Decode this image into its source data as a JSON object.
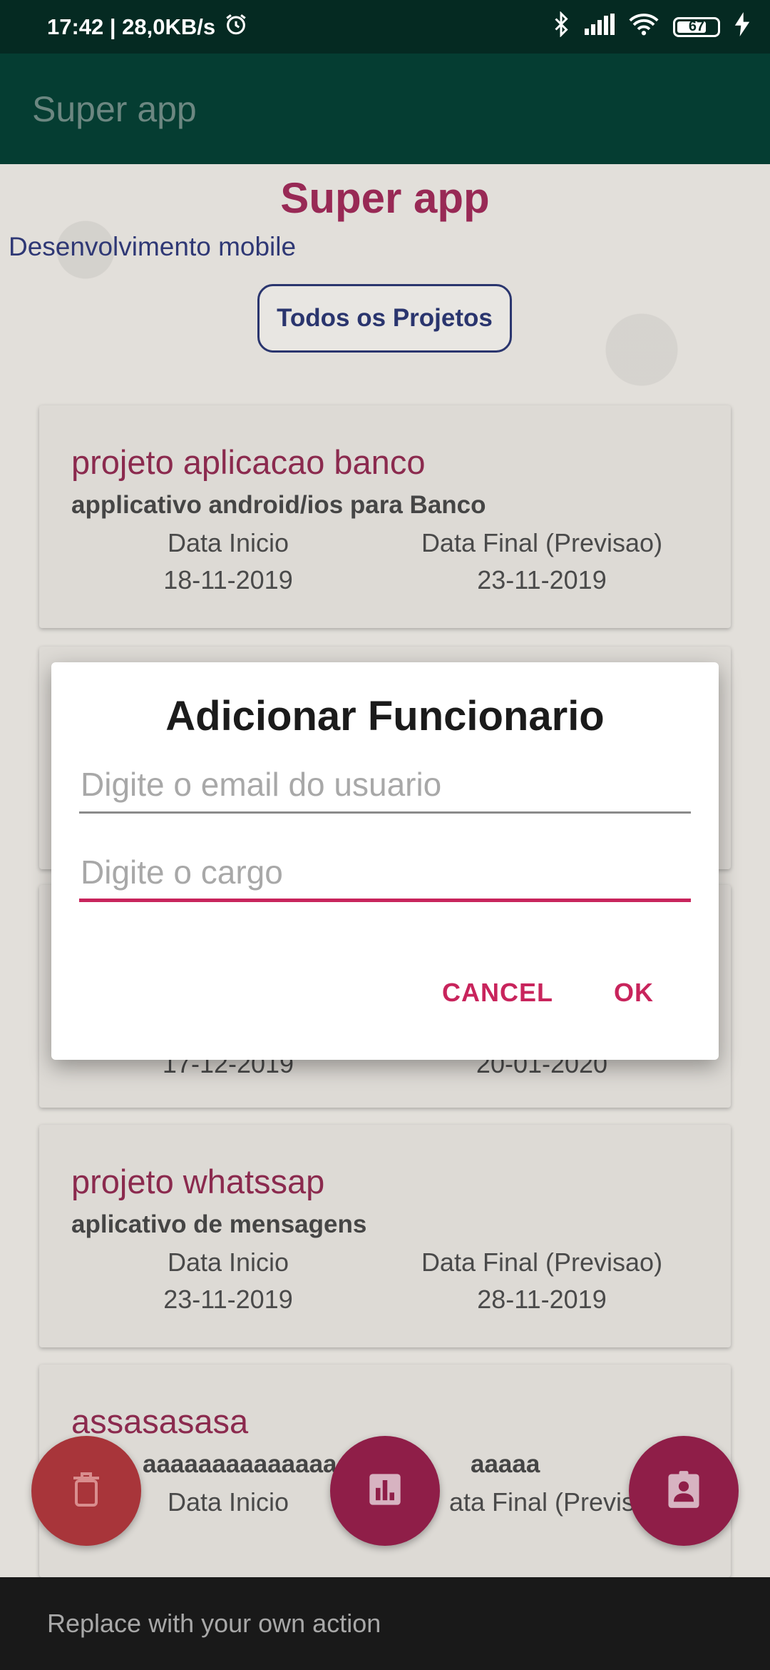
{
  "status_bar": {
    "time_speed": "17:42 | 28,0KB/s",
    "battery_level": "67"
  },
  "toolbar": {
    "title": "Super app"
  },
  "header": {
    "title": "Super app",
    "subtitle": "Desenvolvimento mobile",
    "all_projects_label": "Todos os Projetos"
  },
  "projects": [
    {
      "title": "projeto aplicacao banco",
      "description": "applicativo android/ios para Banco",
      "start_label": "Data Inicio",
      "end_label": "Data Final (Previsao)",
      "start_date": "18-11-2019",
      "end_date": "23-11-2019"
    },
    {
      "start_date_partial": "17-12-2019",
      "end_date_partial": "20-01-2020"
    },
    {
      "title": "projeto  whatssap",
      "description": "aplicativo de mensagens",
      "start_label": "Data Inicio",
      "end_label": "Data Final (Previsao)",
      "start_date": "23-11-2019",
      "end_date": "28-11-2019"
    },
    {
      "title": "assasasasa",
      "description_partial_left": "aaaaaaaaaaaaaaaa",
      "description_partial_right": "aaaaa",
      "start_label": "Data Inicio",
      "end_label_partial": "ata Final (Previs"
    }
  ],
  "dialog": {
    "title": "Adicionar Funcionario",
    "email_placeholder": "Digite o email do usuario",
    "role_placeholder": "Digite o cargo",
    "cancel_label": "CANCEL",
    "ok_label": "OK"
  },
  "snackbar": {
    "text": "Replace with your own action"
  },
  "colors": {
    "primary": "#063f33",
    "accent": "#c8245c",
    "project_title": "#8e2b50"
  }
}
